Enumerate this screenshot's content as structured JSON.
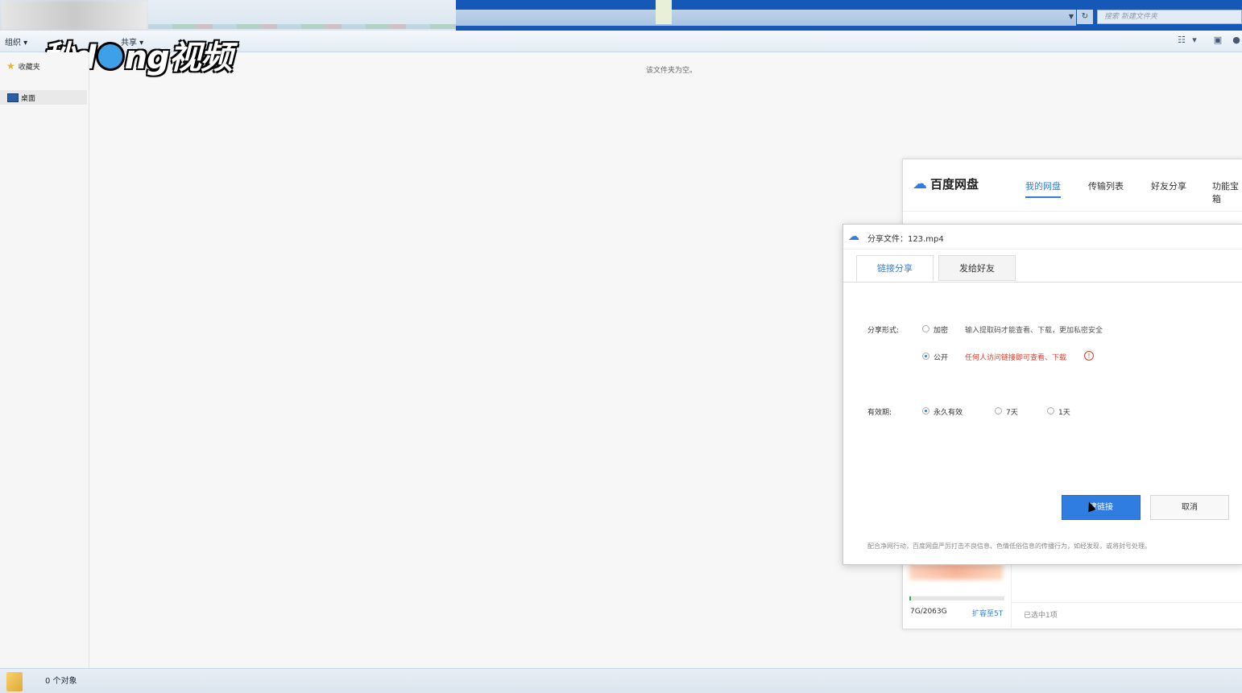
{
  "explorer": {
    "search_placeholder": "搜索 新建文件夹",
    "toolbar": {
      "organize": "组织 ▾",
      "share": "共享 ▾"
    },
    "sidebar": {
      "favorites": "收藏夹",
      "desktop": "桌面"
    },
    "empty_message": "该文件夹为空。",
    "status_count": "0 个对象"
  },
  "watermark": {
    "text_left": "秒d",
    "text_right": "ng视频"
  },
  "baidu": {
    "brand": "百度网盘",
    "nav": [
      "我的网盘",
      "传输列表",
      "好友分享",
      "功能宝箱"
    ],
    "quota": "7G/2063G",
    "expand": "扩容至5T",
    "selected": "已选中1项",
    "quota_used_fraction": 0.003
  },
  "dialog": {
    "title": "分享文件：123.mp4",
    "tabs": [
      "链接分享",
      "发给好友"
    ],
    "share_type_label": "分享形式:",
    "option_private": "加密",
    "option_private_desc": "输入提取码才能查看、下载，更加私密安全",
    "option_public": "公开",
    "option_public_desc": "任何人访问链接即可查看、下载",
    "validity_label": "有效期:",
    "validity_options": [
      "永久有效",
      "7天",
      "1天"
    ],
    "create_button": "建链接",
    "cancel_button": "取消",
    "notice": "配合净网行动，百度网盘严厉打击不良信息、色情低俗信息的传播行为，如经发现，或将封号处理。"
  },
  "colors": {
    "accent": "#2f7de1",
    "warning": "#e23c2b"
  }
}
